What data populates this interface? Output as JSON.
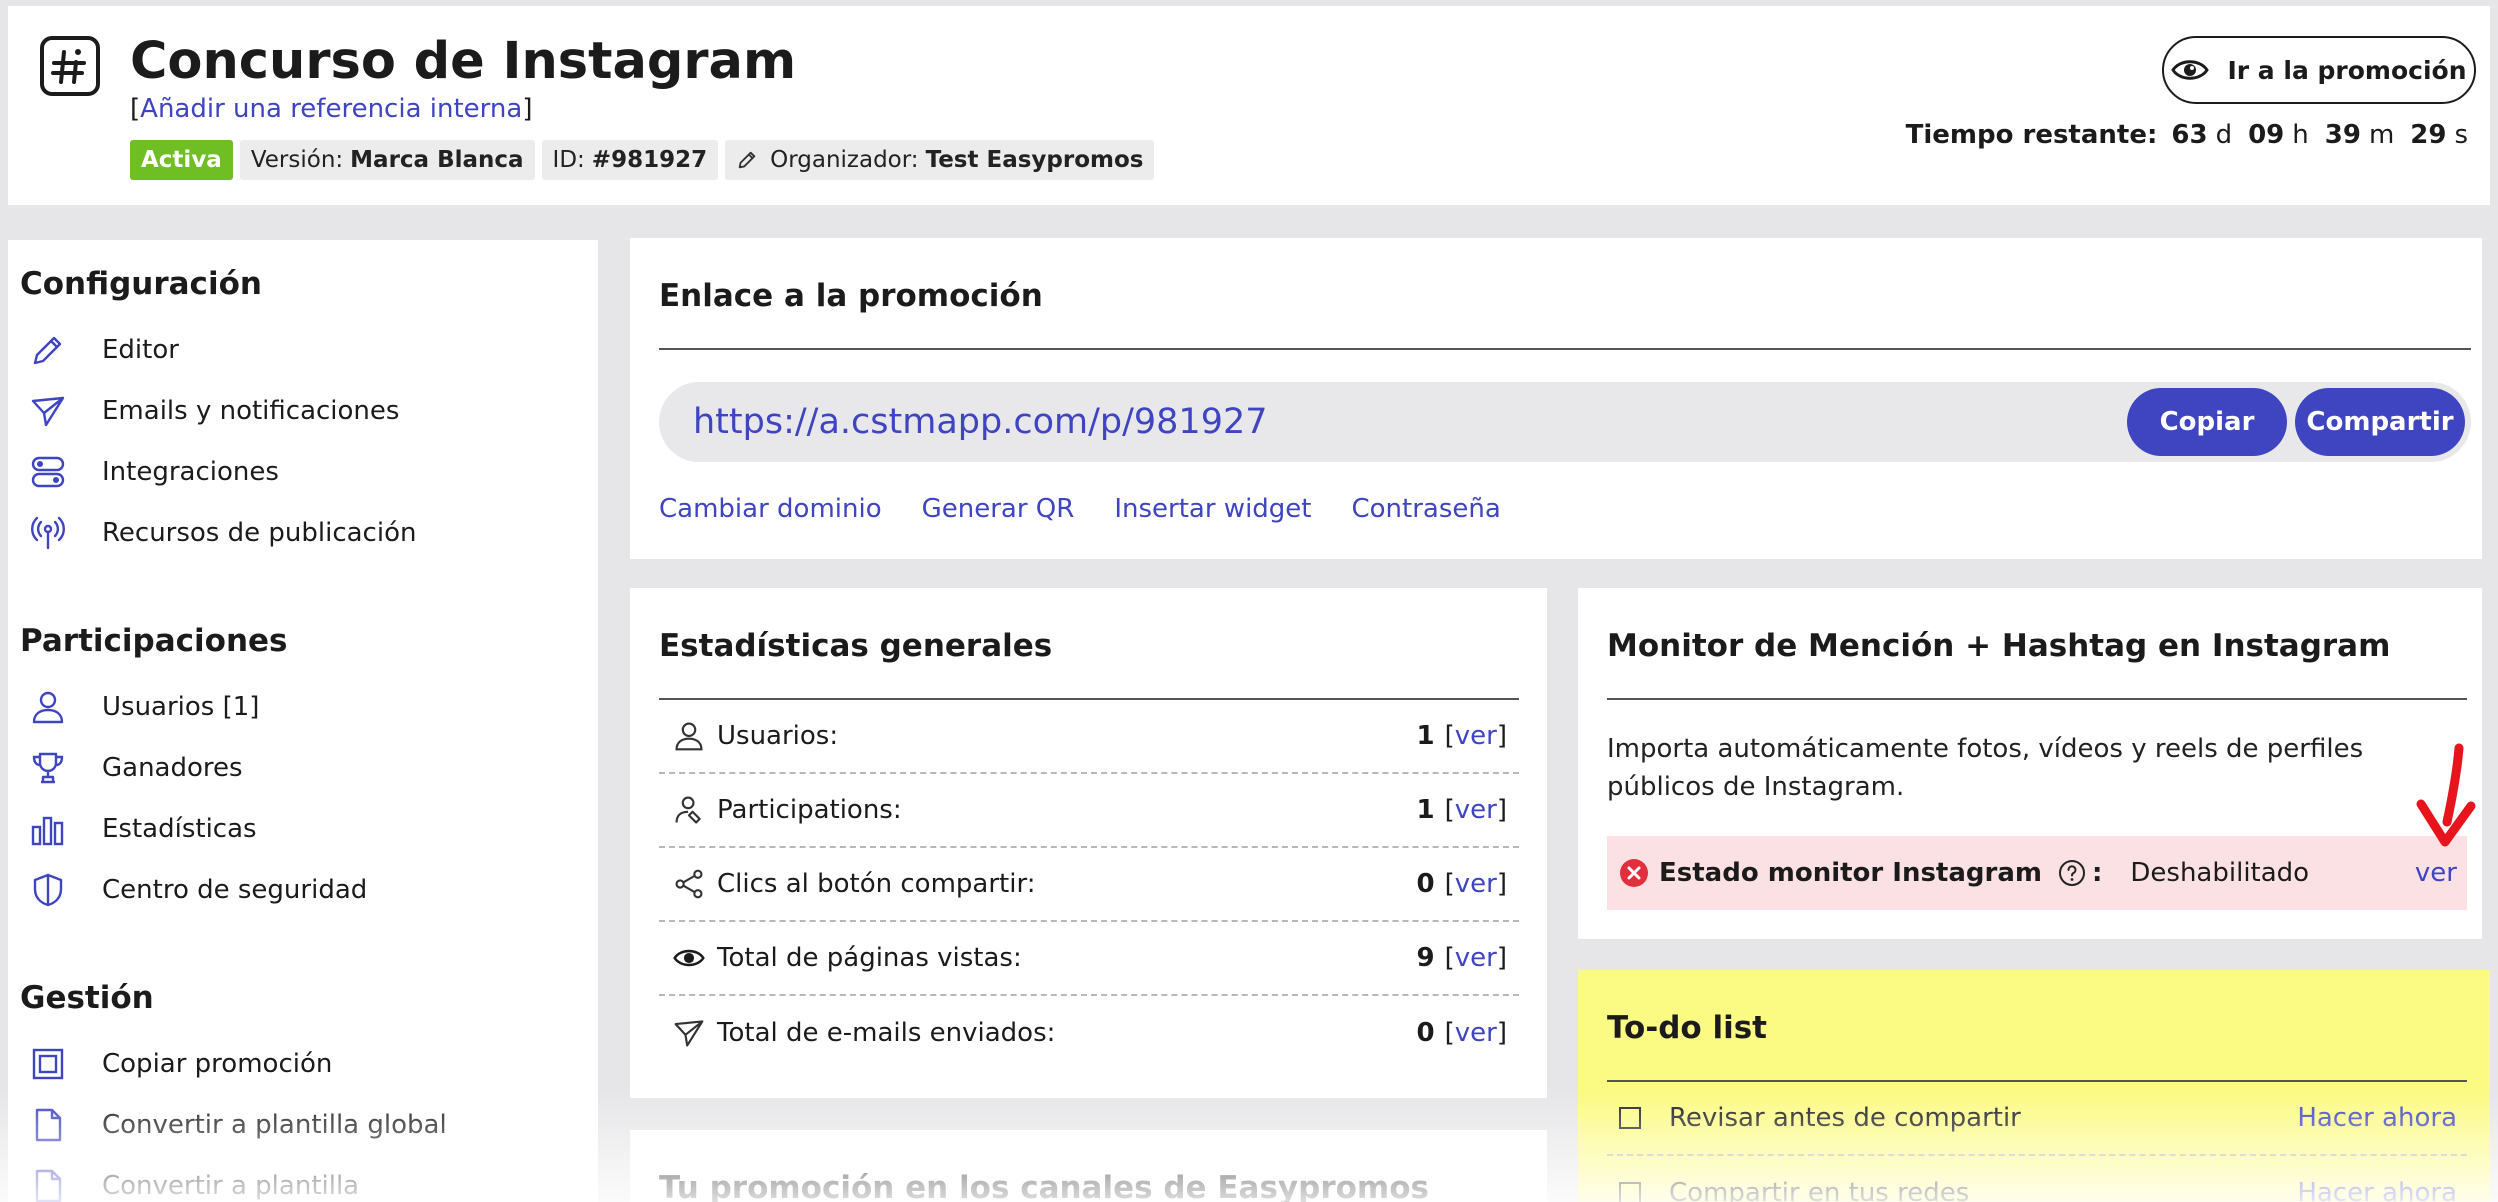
{
  "header": {
    "title": "Concurso de Instagram",
    "ref_open": "[",
    "ref_link": "Añadir una referencia interna",
    "ref_close": "]",
    "status_badge": "Activa",
    "version_label": "Versión:",
    "version_value": "Marca Blanca",
    "id_label": "ID:",
    "id_value": "#981927",
    "organizer_label": "Organizador:",
    "organizer_value": "Test Easypromos",
    "go_button": "Ir a la promoción",
    "timer": {
      "label": "Tiempo restante:",
      "days": "63",
      "days_unit": "d",
      "hours": "09",
      "hours_unit": "h",
      "minutes": "39",
      "minutes_unit": "m",
      "seconds": "29",
      "seconds_unit": "s"
    }
  },
  "sidebar": {
    "configuracion": {
      "heading": "Configuración",
      "items": [
        {
          "label": "Editor",
          "icon": "pencil-icon"
        },
        {
          "label": "Emails y notificaciones",
          "icon": "send-icon"
        },
        {
          "label": "Integraciones",
          "icon": "toggles-icon"
        },
        {
          "label": "Recursos de publicación",
          "icon": "broadcast-icon"
        }
      ]
    },
    "participaciones": {
      "heading": "Participaciones",
      "items": [
        {
          "label": "Usuarios [1]",
          "icon": "user-icon"
        },
        {
          "label": "Ganadores",
          "icon": "trophy-icon"
        },
        {
          "label": "Estadísticas",
          "icon": "bar-chart-icon"
        },
        {
          "label": "Centro de seguridad",
          "icon": "shield-icon"
        }
      ]
    },
    "gestion": {
      "heading": "Gestión",
      "items": [
        {
          "label": "Copiar promoción",
          "icon": "copy-icon"
        },
        {
          "label": "Convertir a plantilla global",
          "icon": "file-icon"
        },
        {
          "label": "Convertir a plantilla",
          "icon": "file-icon"
        }
      ]
    }
  },
  "link_card": {
    "title": "Enlace a la promoción",
    "url": "https://a.cstmapp.com/p/981927",
    "copy_button": "Copiar",
    "share_button": "Compartir",
    "actions": [
      "Cambiar dominio",
      "Generar QR",
      "Insertar widget",
      "Contraseña"
    ]
  },
  "stats_card": {
    "title": "Estadísticas generales",
    "rows": [
      {
        "label": "Usuarios:",
        "value": "1",
        "icon": "user-icon"
      },
      {
        "label": "Participations:",
        "value": "1",
        "icon": "participation-icon"
      },
      {
        "label": "Clics al botón compartir:",
        "value": "0",
        "icon": "share-icon"
      },
      {
        "label": "Total de páginas vistas:",
        "value": "9",
        "icon": "eye-icon"
      },
      {
        "label": "Total de e-mails enviados:",
        "value": "0",
        "icon": "send-icon"
      }
    ],
    "link_open": "[",
    "link_text": "ver",
    "link_close": "]"
  },
  "monitor_card": {
    "title": "Monitor de Mención + Hashtag en Instagram",
    "description": "Importa automáticamente fotos, vídeos y reels de perfiles públicos de Instagram.",
    "status_label": "Estado monitor Instagram",
    "colon": ":",
    "status_value": "Deshabilitado",
    "view_link": "ver"
  },
  "todo_card": {
    "title": "To-do list",
    "items": [
      {
        "label": "Revisar antes de compartir",
        "action": "Hacer ahora"
      },
      {
        "label": "Compartir en tus redes",
        "action": "Hacer ahora"
      }
    ]
  },
  "bottom_card": {
    "title": "Tu promoción en los canales de Easypromos"
  },
  "colors": {
    "accent": "#3f44c1",
    "active_green": "#6fbf24",
    "error_red": "#e0303d",
    "todo_yellow": "#fbfa82",
    "status_pink": "#fbe1e3"
  }
}
